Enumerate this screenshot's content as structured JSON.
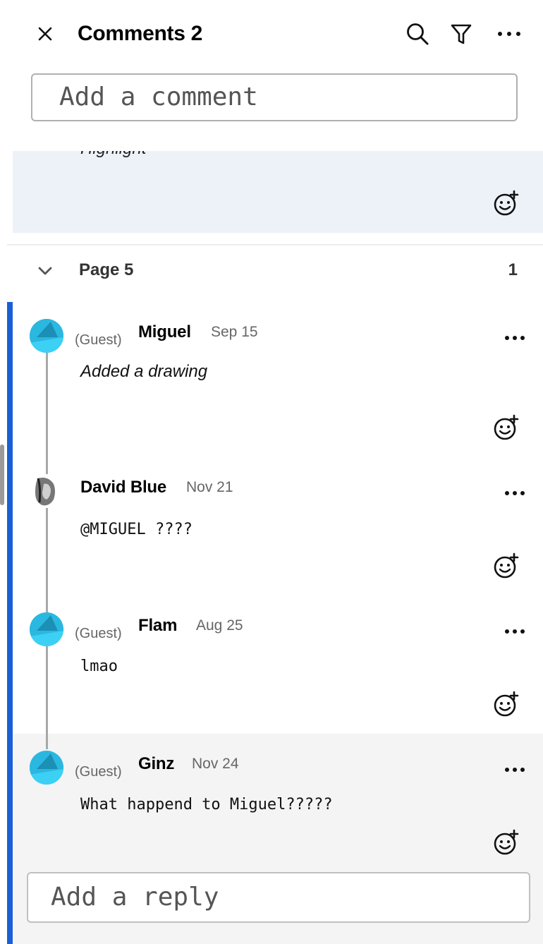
{
  "header": {
    "title": "Comments 2",
    "icons": [
      "close-icon",
      "search-icon",
      "filter-icon",
      "more-icon"
    ]
  },
  "add_comment": {
    "placeholder": "Add a comment"
  },
  "previous_card": {
    "text": "Highlight"
  },
  "page_group": {
    "label": "Page 5",
    "count": "1"
  },
  "comments": [
    {
      "guest": "(Guest)",
      "author": "Miguel",
      "date": "Sep 15",
      "body": "Added a drawing"
    },
    {
      "guest": "",
      "author": "David Blue",
      "date": "Nov 21",
      "body": "@MIGUEL ????"
    },
    {
      "guest": "(Guest)",
      "author": "Flam",
      "date": "Aug 25",
      "body": "lmao"
    },
    {
      "guest": "(Guest)",
      "author": "Ginz",
      "date": "Nov 24",
      "body": "What happend to Miguel?????"
    }
  ],
  "add_reply": {
    "placeholder": "Add a reply"
  },
  "colors": {
    "accent_bar": "#1a5fd6",
    "avatar": "#2ab8e0",
    "highlight_card": "#edf2f9",
    "selected_comment": "#f4f4f4"
  }
}
